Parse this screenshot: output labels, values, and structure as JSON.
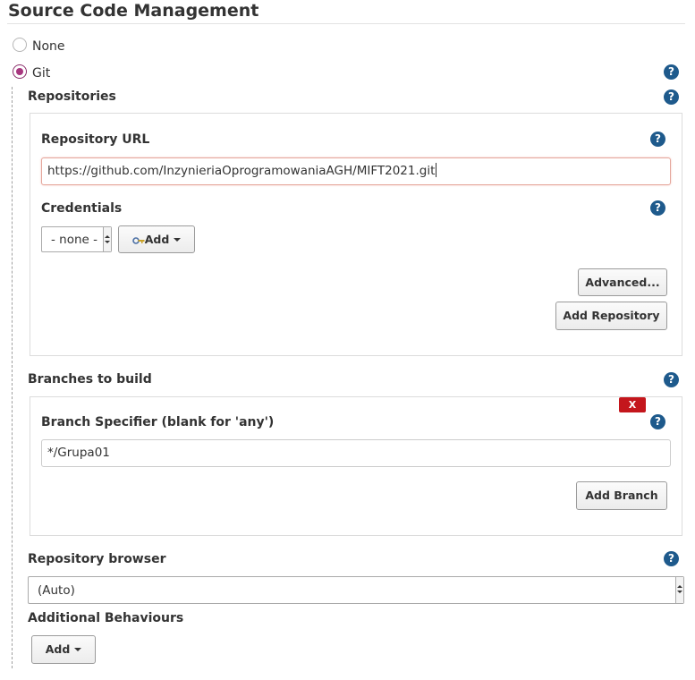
{
  "section": {
    "title": "Source Code Management"
  },
  "scm_options": {
    "none_label": "None",
    "git_label": "Git",
    "selected": "Git"
  },
  "repositories": {
    "label": "Repositories",
    "url_label": "Repository URL",
    "url_value": "https://github.com/InzynieriaOprogramowaniaAGH/MIFT2021.git",
    "credentials_label": "Credentials",
    "credentials_value": "- none -",
    "add_credentials_label": "Add",
    "advanced_label": "Advanced...",
    "add_repository_label": "Add Repository"
  },
  "branches": {
    "label": "Branches to build",
    "delete_label": "X",
    "specifier_label": "Branch Specifier (blank for 'any')",
    "specifier_value": "*/Grupa01",
    "add_branch_label": "Add Branch"
  },
  "repository_browser": {
    "label": "Repository browser",
    "value": "(Auto)"
  },
  "additional_behaviours": {
    "label": "Additional Behaviours",
    "add_label": "Add"
  },
  "help_icon_glyph": "?",
  "colors": {
    "help_icon": "#1e5a8c",
    "radio_selected": "#a8377f",
    "delete_button": "#c4161c",
    "error_border": "#e5a79c"
  }
}
